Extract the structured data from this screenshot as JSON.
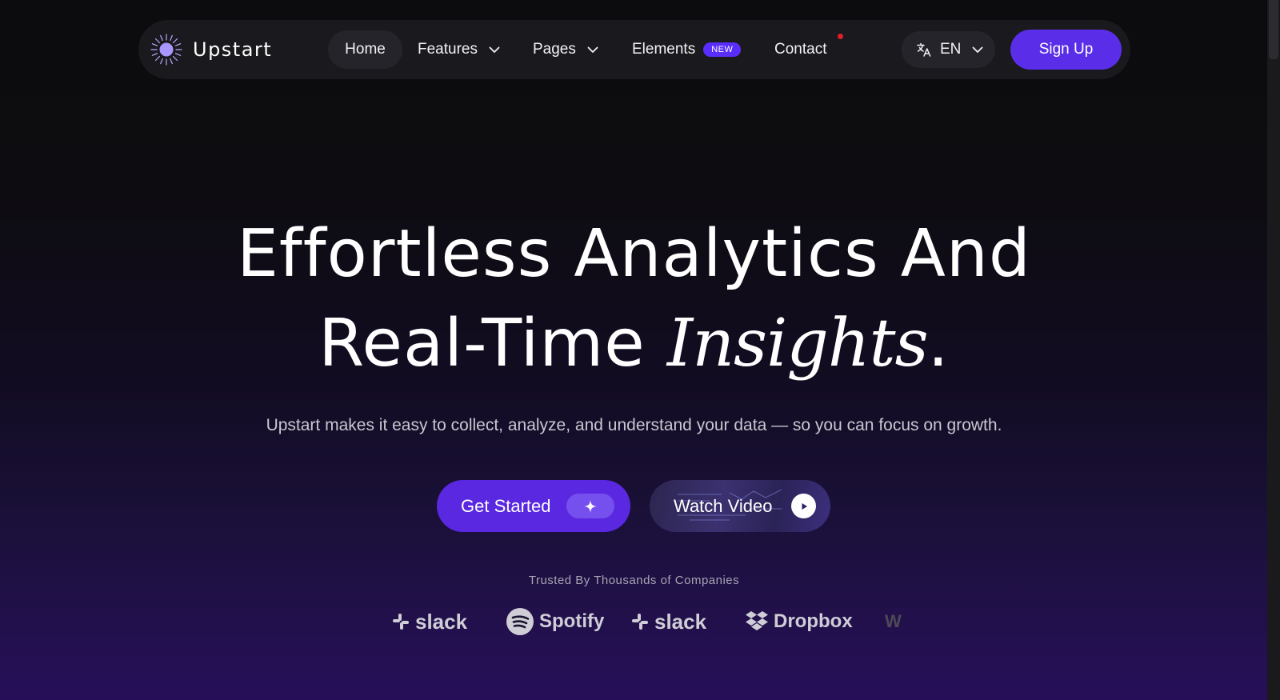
{
  "brand": {
    "name": "Upstart",
    "accent": "#5a2ee8"
  },
  "nav": {
    "home": "Home",
    "features": "Features",
    "pages": "Pages",
    "elements": "Elements",
    "elements_badge": "NEW",
    "contact": "Contact"
  },
  "lang": {
    "code": "EN",
    "icon": "translate-icon"
  },
  "signup": "Sign Up",
  "hero": {
    "line1": "Effortless Analytics And",
    "line2_regular": "Real-Time ",
    "line2_italic": "Insights",
    "line2_end": ".",
    "subtitle": "Upstart makes it easy to collect, analyze, and understand your data — so you can focus on growth."
  },
  "cta": {
    "primary": "Get Started",
    "secondary": "Watch Video"
  },
  "trusted": "Trusted By Thousands of Companies",
  "logos": [
    "slack",
    "Spotify",
    "slack",
    "Dropbox",
    "W"
  ]
}
